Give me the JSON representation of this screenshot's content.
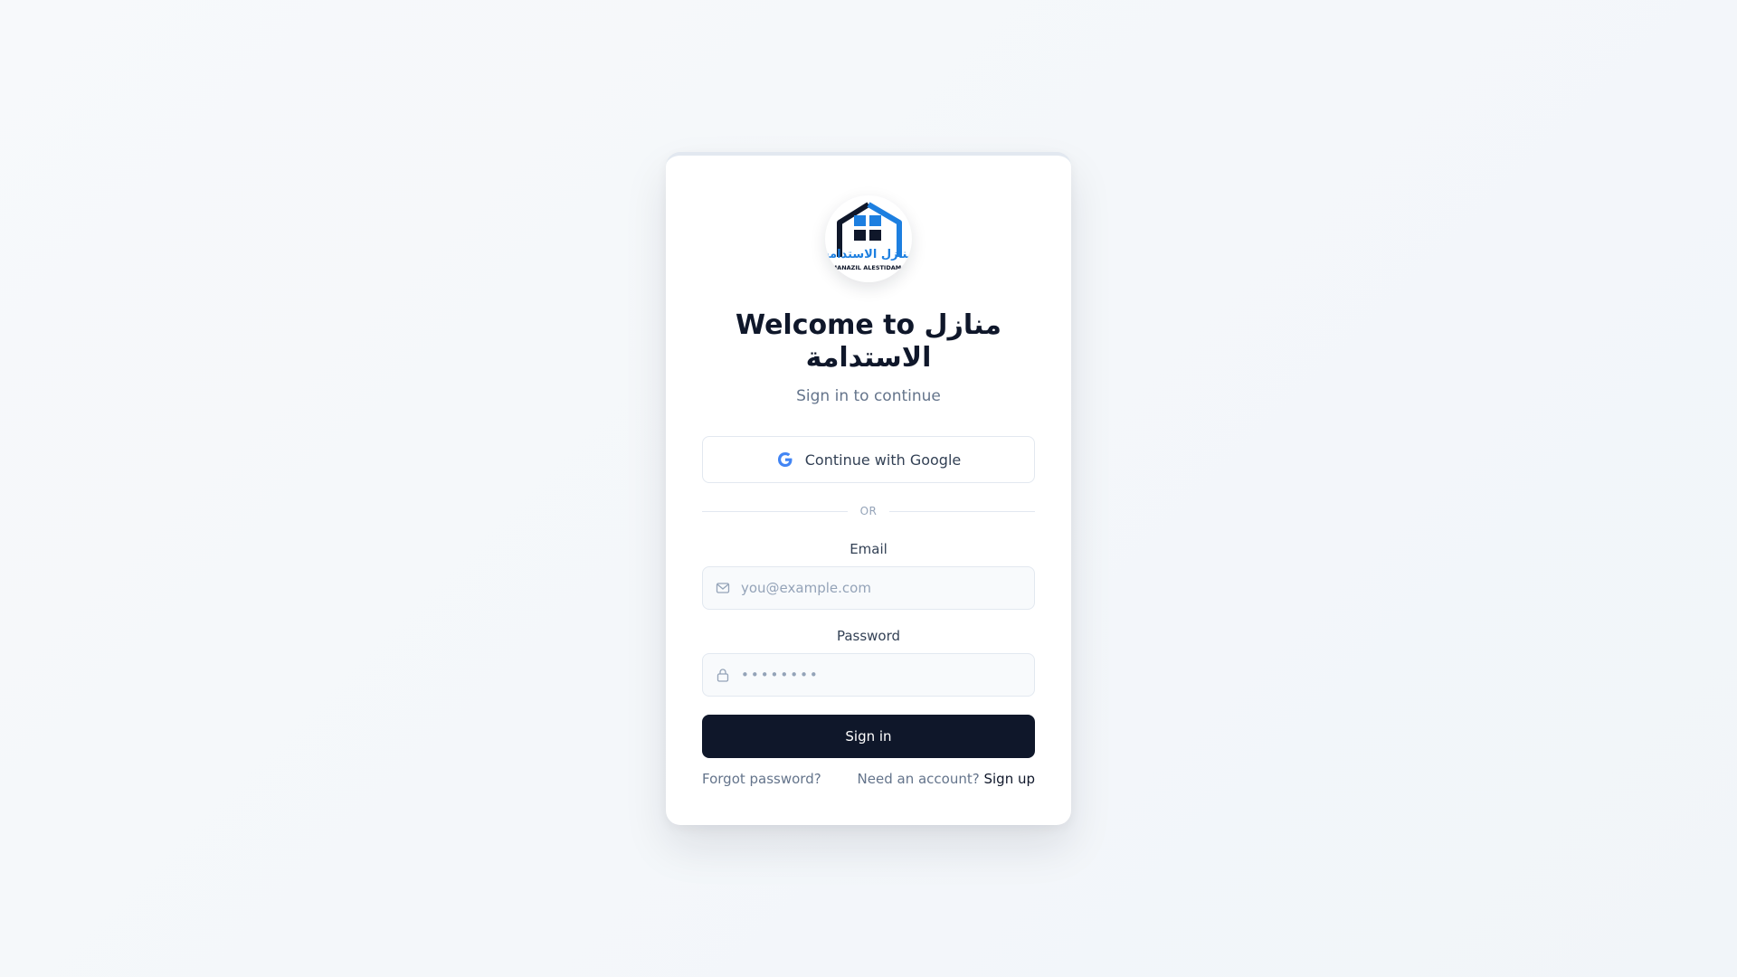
{
  "logo": {
    "arabic_text": "منازل الاستدامة",
    "latin_text": "MANAZIL ALESTIDAMA"
  },
  "title": "Welcome to منازل الاستدامة",
  "subtitle": "Sign in to continue",
  "google_button": {
    "label": "Continue with Google",
    "icon": "google-icon"
  },
  "divider": {
    "label": "OR"
  },
  "email": {
    "label": "Email",
    "placeholder": "you@example.com",
    "icon": "mail-icon"
  },
  "password": {
    "label": "Password",
    "placeholder": "••••••••",
    "icon": "lock-icon"
  },
  "signin_button": {
    "label": "Sign in"
  },
  "footer": {
    "forgot_label": "Forgot password?",
    "need_account_label": "Need an account?",
    "signup_label": "Sign up"
  },
  "colors": {
    "primary": "#0f172a",
    "muted": "#64748b",
    "logo_blue": "#1d7fe0",
    "border": "#e2e8f0"
  }
}
